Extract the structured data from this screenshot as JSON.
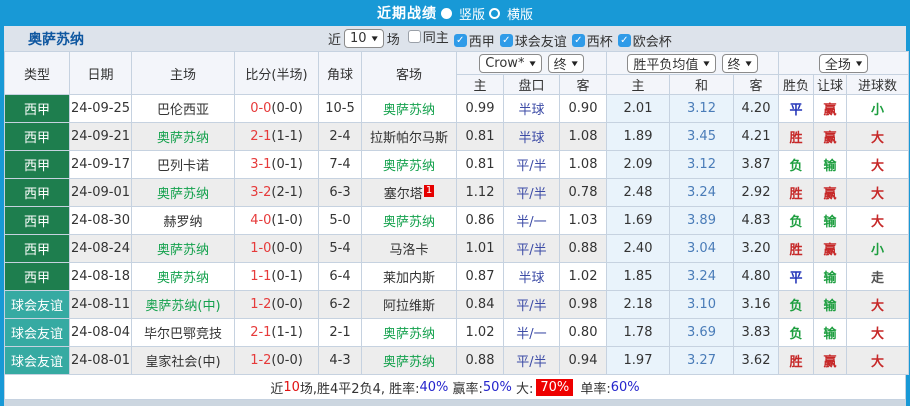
{
  "top_bar": {
    "title": "近期战绩",
    "options": [
      {
        "label": "竖版",
        "selected": true
      },
      {
        "label": "横版",
        "selected": false
      }
    ]
  },
  "filter_bar": {
    "team_title": "奥萨苏纳",
    "recent_label_prefix": "近",
    "recent_select_value": "10",
    "recent_label_suffix": "场",
    "checkboxes": [
      {
        "label": "同主",
        "checked": false
      },
      {
        "label": "西甲",
        "checked": true
      },
      {
        "label": "球会友谊",
        "checked": true
      },
      {
        "label": "西杯",
        "checked": true
      },
      {
        "label": "欧会杯",
        "checked": true
      }
    ]
  },
  "icons": {
    "dropdown_caret": "▼",
    "checkbox_check": "✓",
    "radio_filled": "●",
    "radio_empty": "○"
  },
  "table": {
    "left_headers": [
      "类型",
      "日期",
      "主场",
      "比分(半场)",
      "角球",
      "客场"
    ],
    "dropdowns": {
      "odds_company": "Crow*",
      "odds_final": "终",
      "avg": "胜平负均值",
      "avg_final": "终",
      "scope": "全场"
    },
    "sub_headers": [
      "主",
      "盘口",
      "客",
      "主",
      "和",
      "客",
      "胜负",
      "让球",
      "进球数"
    ],
    "rows": [
      {
        "type": "西甲",
        "type_key": "liga",
        "date": "24-09-25",
        "home": "巴伦西亚",
        "home_is_team": false,
        "score": "0-0",
        "half": "(0-0)",
        "corner": "10-5",
        "away": "奥萨苏纳",
        "away_is_team": true,
        "away_badge": "",
        "odds_home": "0.99",
        "handicap": "半球",
        "odds_away": "0.90",
        "avg_home": "2.01",
        "avg_draw": "3.12",
        "avg_away": "4.20",
        "result": "平",
        "result_color": "blue",
        "let_result": "赢",
        "let_color": "red",
        "goal_result": "小",
        "goal_color": "green"
      },
      {
        "type": "西甲",
        "type_key": "liga",
        "date": "24-09-21",
        "home": "奥萨苏纳",
        "home_is_team": true,
        "score": "2-1",
        "half": "(1-1)",
        "corner": "2-4",
        "away": "拉斯帕尔马斯",
        "away_is_team": false,
        "away_badge": "",
        "odds_home": "0.81",
        "handicap": "半球",
        "odds_away": "1.08",
        "avg_home": "1.89",
        "avg_draw": "3.45",
        "avg_away": "4.21",
        "result": "胜",
        "result_color": "red",
        "let_result": "赢",
        "let_color": "red",
        "goal_result": "大",
        "goal_color": "red"
      },
      {
        "type": "西甲",
        "type_key": "liga",
        "date": "24-09-17",
        "home": "巴列卡诺",
        "home_is_team": false,
        "score": "3-1",
        "half": "(0-1)",
        "corner": "7-4",
        "away": "奥萨苏纳",
        "away_is_team": true,
        "away_badge": "",
        "odds_home": "0.81",
        "handicap": "平/半",
        "odds_away": "1.08",
        "avg_home": "2.09",
        "avg_draw": "3.12",
        "avg_away": "3.87",
        "result": "负",
        "result_color": "green",
        "let_result": "输",
        "let_color": "green",
        "goal_result": "大",
        "goal_color": "red"
      },
      {
        "type": "西甲",
        "type_key": "liga",
        "date": "24-09-01",
        "home": "奥萨苏纳",
        "home_is_team": true,
        "score": "3-2",
        "half": "(2-1)",
        "corner": "6-3",
        "away": "塞尔塔",
        "away_is_team": false,
        "away_badge": "1",
        "odds_home": "1.12",
        "handicap": "平/半",
        "odds_away": "0.78",
        "avg_home": "2.48",
        "avg_draw": "3.24",
        "avg_away": "2.92",
        "result": "胜",
        "result_color": "red",
        "let_result": "赢",
        "let_color": "red",
        "goal_result": "大",
        "goal_color": "red"
      },
      {
        "type": "西甲",
        "type_key": "liga",
        "date": "24-08-30",
        "home": "赫罗纳",
        "home_is_team": false,
        "score": "4-0",
        "half": "(1-0)",
        "corner": "5-0",
        "away": "奥萨苏纳",
        "away_is_team": true,
        "away_badge": "",
        "odds_home": "0.86",
        "handicap": "半/一",
        "odds_away": "1.03",
        "avg_home": "1.69",
        "avg_draw": "3.89",
        "avg_away": "4.83",
        "result": "负",
        "result_color": "green",
        "let_result": "输",
        "let_color": "green",
        "goal_result": "大",
        "goal_color": "red"
      },
      {
        "type": "西甲",
        "type_key": "liga",
        "date": "24-08-24",
        "home": "奥萨苏纳",
        "home_is_team": true,
        "score": "1-0",
        "half": "(0-0)",
        "corner": "5-4",
        "away": "马洛卡",
        "away_is_team": false,
        "away_badge": "",
        "odds_home": "1.01",
        "handicap": "平/半",
        "odds_away": "0.88",
        "avg_home": "2.40",
        "avg_draw": "3.04",
        "avg_away": "3.20",
        "result": "胜",
        "result_color": "red",
        "let_result": "赢",
        "let_color": "red",
        "goal_result": "小",
        "goal_color": "green"
      },
      {
        "type": "西甲",
        "type_key": "liga",
        "date": "24-08-18",
        "home": "奥萨苏纳",
        "home_is_team": true,
        "score": "1-1",
        "half": "(0-1)",
        "corner": "6-4",
        "away": "莱加内斯",
        "away_is_team": false,
        "away_badge": "",
        "odds_home": "0.87",
        "handicap": "半球",
        "odds_away": "1.02",
        "avg_home": "1.85",
        "avg_draw": "3.24",
        "avg_away": "4.80",
        "result": "平",
        "result_color": "blue",
        "let_result": "输",
        "let_color": "green",
        "goal_result": "走",
        "goal_color": "dark"
      },
      {
        "type": "球会友谊",
        "type_key": "friendly",
        "date": "24-08-11",
        "home": "奥萨苏纳(中)",
        "home_is_team": true,
        "score": "1-2",
        "half": "(0-0)",
        "corner": "6-2",
        "away": "阿拉维斯",
        "away_is_team": false,
        "away_badge": "",
        "odds_home": "0.84",
        "handicap": "平/半",
        "odds_away": "0.98",
        "avg_home": "2.18",
        "avg_draw": "3.10",
        "avg_away": "3.16",
        "result": "负",
        "result_color": "green",
        "let_result": "输",
        "let_color": "green",
        "goal_result": "大",
        "goal_color": "red"
      },
      {
        "type": "球会友谊",
        "type_key": "friendly",
        "date": "24-08-04",
        "home": "毕尔巴鄂竞技",
        "home_is_team": false,
        "score": "2-1",
        "half": "(1-1)",
        "corner": "2-1",
        "away": "奥萨苏纳",
        "away_is_team": true,
        "away_badge": "",
        "odds_home": "1.02",
        "handicap": "半/一",
        "odds_away": "0.80",
        "avg_home": "1.78",
        "avg_draw": "3.69",
        "avg_away": "3.83",
        "result": "负",
        "result_color": "green",
        "let_result": "输",
        "let_color": "green",
        "goal_result": "大",
        "goal_color": "red"
      },
      {
        "type": "球会友谊",
        "type_key": "friendly",
        "date": "24-08-01",
        "home": "皇家社会(中)",
        "home_is_team": false,
        "score": "1-2",
        "half": "(0-0)",
        "corner": "4-3",
        "away": "奥萨苏纳",
        "away_is_team": true,
        "away_badge": "",
        "odds_home": "0.88",
        "handicap": "平/半",
        "odds_away": "0.94",
        "avg_home": "1.97",
        "avg_draw": "3.27",
        "avg_away": "3.62",
        "result": "胜",
        "result_color": "red",
        "let_result": "赢",
        "let_color": "red",
        "goal_result": "大",
        "goal_color": "red"
      }
    ]
  },
  "summary": {
    "parts": [
      {
        "text": "近",
        "style": "dark"
      },
      {
        "text": "10",
        "style": "red"
      },
      {
        "text": "场,胜4平2负4, 胜率:",
        "style": "dark"
      },
      {
        "text": "40%",
        "style": "blue"
      },
      {
        "text": " 赢率:",
        "style": "dark"
      },
      {
        "text": "50%",
        "style": "blue"
      },
      {
        "text": " 大:",
        "style": "dark"
      },
      {
        "text": "70%",
        "style": "badge"
      },
      {
        "text": " 单率:",
        "style": "dark"
      },
      {
        "text": "60%",
        "style": "blue"
      }
    ]
  },
  "colors": {
    "page_bg": "#1899d6",
    "filter_bg": "#dde3eb",
    "liga_green": "#1e7e4e",
    "friendly_teal": "#36aaa2",
    "team_green": "#14a14d",
    "score_red": "#e63a3a",
    "handicap_blue": "#3c4ba6",
    "avg_bg": "#e9f3fb",
    "avg_mid_blue": "#4a7cb8",
    "win_red": "#c62828",
    "draw_blue": "#2334b8",
    "lose_green": "#1d9e3f",
    "pct_blue": "#2424cc",
    "badge_red": "#ee0000",
    "title_blue": "#0f57a0"
  }
}
